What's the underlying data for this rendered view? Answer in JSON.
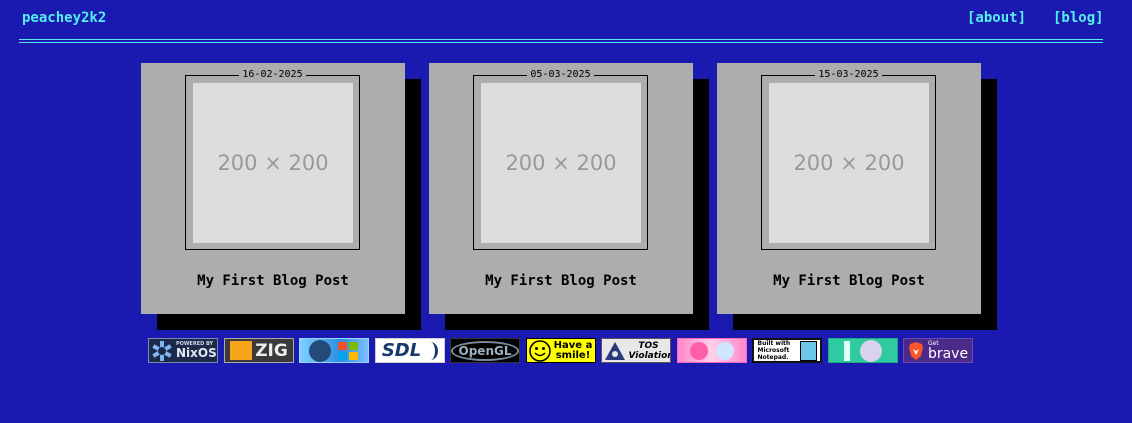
{
  "header": {
    "site_name": "peachey2k2",
    "nav": [
      {
        "label": "[about]"
      },
      {
        "label": "[blog]"
      }
    ]
  },
  "posts": [
    {
      "date": "16-02-2025",
      "thumb_text": "200 × 200",
      "title": "My First Blog Post"
    },
    {
      "date": "05-03-2025",
      "thumb_text": "200 × 200",
      "title": "My First Blog Post"
    },
    {
      "date": "15-03-2025",
      "thumb_text": "200 × 200",
      "title": "My First Blog Post"
    }
  ],
  "badges": {
    "nixos": {
      "small": "POWERED BY",
      "big": "NixOS"
    },
    "zig": {
      "big": "ZIG"
    },
    "sdl": {
      "big": "SDL"
    },
    "opengl": {
      "big": "OpenGL"
    },
    "smile": {
      "big": "Have a smile!"
    },
    "tos": {
      "big": "TOS Violation"
    },
    "notepad": {
      "big": "Built with Microsoft Notepad."
    },
    "brave": {
      "small": "Get",
      "big": "brave"
    }
  },
  "colors": {
    "background": "#1a1ab1",
    "accent": "#55eeee",
    "card": "#adadad",
    "shadow": "#000000",
    "thumb": "#dddddd"
  }
}
